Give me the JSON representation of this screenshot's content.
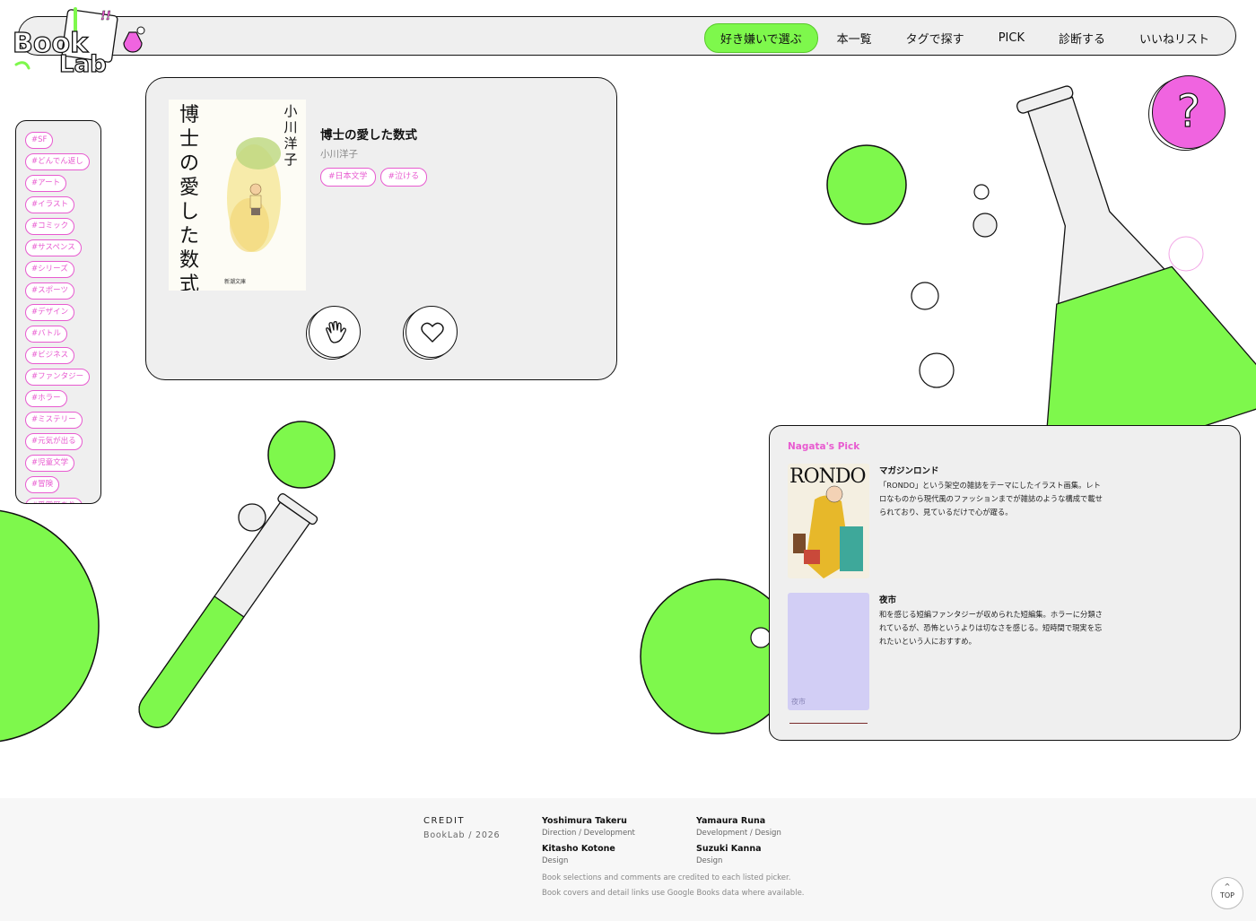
{
  "header": {
    "logo": {
      "part1": "Book",
      "part2": "Lab",
      "mark": "!!"
    },
    "nav": [
      {
        "label": "好き嫌いで選ぶ",
        "active": true
      },
      {
        "label": "本一覧",
        "active": false
      },
      {
        "label": "タグで探す",
        "active": false
      },
      {
        "label": "PICK",
        "active": false
      },
      {
        "label": "診断する",
        "active": false
      },
      {
        "label": "いいねリスト",
        "active": false
      }
    ]
  },
  "tags": [
    "#SF",
    "#どんでん返し",
    "#アート",
    "#イラスト",
    "#コミック",
    "#サスペンス",
    "#シリーズ",
    "#スポーツ",
    "#デザイン",
    "#バトル",
    "#ビジネス",
    "#ファンタジー",
    "#ホラー",
    "#ミステリー",
    "#元気が出る",
    "#児童文学",
    "#冒険",
    "#受賞歴あり"
  ],
  "book": {
    "title": "博士の愛した数式",
    "author": "小川洋子",
    "tags": [
      "#日本文学",
      "#泣ける"
    ],
    "cover": {
      "title_vertical": [
        "博",
        "士",
        "の",
        "愛",
        "し",
        "た",
        "数",
        "式"
      ],
      "author_vertical": [
        "小",
        "川",
        "洋",
        "子"
      ],
      "publisher": "新潮文庫"
    },
    "dislike_icon": "hand-icon",
    "like_icon": "heart-icon"
  },
  "help": {
    "mark": "?"
  },
  "pick": {
    "heading": "Nagata's Pick",
    "items": [
      {
        "title": "マガジンロンド",
        "description": "「RONDO」という架空の雑誌をテーマにしたイラスト画集。レトロなものから現代風のファッションまでが雑誌のような構成で載せられており、見ているだけで心が躍る。",
        "cover_text": "RONDO"
      },
      {
        "title": "夜市",
        "description": "和を感じる短編ファンタジーが収められた短編集。ホラーに分類されているが、恐怖というよりは切なさを感じる。短時間で現実を忘れたいという人におすすめ。",
        "cover_text": "夜市",
        "cover_color": "#d2cef5"
      }
    ]
  },
  "footer": {
    "credit_label": "CREDIT",
    "credit_sub": "BookLab / 2026",
    "members": [
      {
        "name": "Yoshimura Takeru",
        "role": "Direction / Development"
      },
      {
        "name": "Yamaura Runa",
        "role": "Development / Design"
      },
      {
        "name": "Kitasho Kotone",
        "role": "Design"
      },
      {
        "name": "Suzuki Kanna",
        "role": "Design"
      }
    ],
    "notes": [
      "Book selections and comments are credited to each listed picker.",
      "Book covers and detail links use Google Books data where available."
    ],
    "top_label": "TOP",
    "top_icon": "chevron-up-icon"
  },
  "colors": {
    "accent_green": "#7ef84c",
    "accent_pink": "#e85bd0",
    "help_pink": "#f064e0",
    "panel": "#efefef"
  }
}
